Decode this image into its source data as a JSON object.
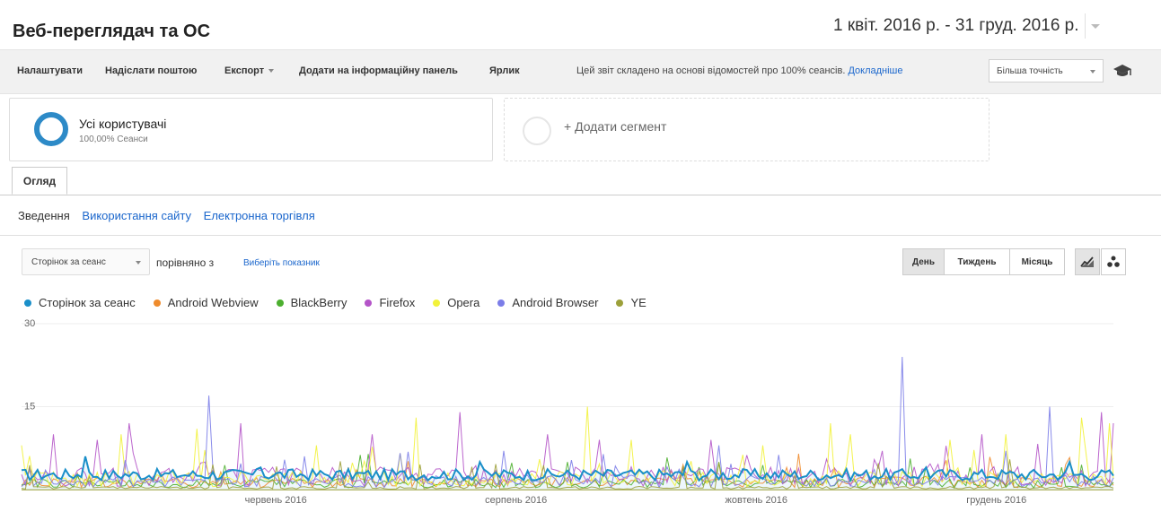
{
  "header": {
    "title": "Веб-переглядач та ОС",
    "date_range": "1 квіт. 2016 р. - 31 груд. 2016 р."
  },
  "toolbar": {
    "items": [
      "Налаштувати",
      "Надіслати поштою",
      "Експорт",
      "Додати на інформаційну панель",
      "Ярлик"
    ],
    "note": "Цей звіт складено на основі відомостей про 100% сеансів.",
    "note_link": "Докладніше",
    "precision": "Більша точність"
  },
  "segments": {
    "active_name": "Усі користувачі",
    "active_pct": "100,00% Сеанси",
    "add": "+ Додати сегмент"
  },
  "tabs": {
    "overview": "Огляд"
  },
  "subnav": {
    "summary": "Зведення",
    "usage": "Використання сайту",
    "ecommerce": "Електронна торгівля"
  },
  "controls": {
    "metric": "Сторінок за сеанс",
    "compare": "порівняно з",
    "choose_metric": "Виберіть показник",
    "day": "День",
    "week": "Тиждень",
    "month": "Місяць"
  },
  "chart_data": {
    "type": "line",
    "y_ticks": [
      "30",
      "15"
    ],
    "ylim": [
      0,
      30
    ],
    "x_tick_labels": [
      "червень 2016",
      "серпень 2016",
      "жовтень 2016",
      "грудень 2016"
    ],
    "x_range": [
      "2016-04-01",
      "2016-12-31"
    ],
    "series": [
      {
        "name": "Сторінок за сеанс",
        "color": "#1a8fc9",
        "base": 2.6,
        "spikes": [
          [
            0.06,
            6
          ],
          [
            0.22,
            4
          ],
          [
            0.42,
            5
          ],
          [
            0.61,
            5
          ],
          [
            0.83,
            4
          ],
          [
            0.96,
            5
          ]
        ]
      },
      {
        "name": "Android Webview",
        "color": "#ef8b2c",
        "base": 1.2,
        "spikes": [
          [
            0.3,
            4
          ],
          [
            0.7,
            4
          ]
        ]
      },
      {
        "name": "BlackBerry",
        "color": "#4caf2f",
        "base": 1.0,
        "spikes": [
          [
            0.5,
            5
          ],
          [
            0.87,
            4
          ]
        ]
      },
      {
        "name": "Firefox",
        "color": "#b454c8",
        "base": 2.2,
        "spikes": [
          [
            0.03,
            10
          ],
          [
            0.07,
            9
          ],
          [
            0.1,
            12
          ],
          [
            0.2,
            12
          ],
          [
            0.32,
            10
          ],
          [
            0.4,
            14
          ],
          [
            0.48,
            10
          ],
          [
            0.53,
            9
          ],
          [
            0.63,
            9
          ],
          [
            0.79,
            7
          ],
          [
            0.88,
            10
          ],
          [
            0.99,
            14
          ],
          [
            1.0,
            12
          ]
        ]
      },
      {
        "name": "Opera",
        "color": "#f2f23a",
        "base": 1.8,
        "spikes": [
          [
            0.0,
            8
          ],
          [
            0.09,
            10
          ],
          [
            0.16,
            11
          ],
          [
            0.27,
            8
          ],
          [
            0.36,
            13
          ],
          [
            0.52,
            15
          ],
          [
            0.56,
            9
          ],
          [
            0.68,
            8
          ],
          [
            0.74,
            12
          ],
          [
            0.76,
            10
          ],
          [
            0.85,
            9
          ],
          [
            0.9,
            10
          ],
          [
            0.97,
            13
          ],
          [
            0.995,
            12
          ]
        ]
      },
      {
        "name": "Android Browser",
        "color": "#7b7de8",
        "base": 1.4,
        "spikes": [
          [
            0.17,
            17
          ],
          [
            0.26,
            6
          ],
          [
            0.44,
            7
          ],
          [
            0.64,
            8
          ],
          [
            0.806,
            24
          ],
          [
            0.9,
            7
          ],
          [
            0.94,
            15
          ]
        ]
      },
      {
        "name": "YE",
        "color": "#9ca03a",
        "base": 0.3,
        "spikes": []
      }
    ]
  }
}
